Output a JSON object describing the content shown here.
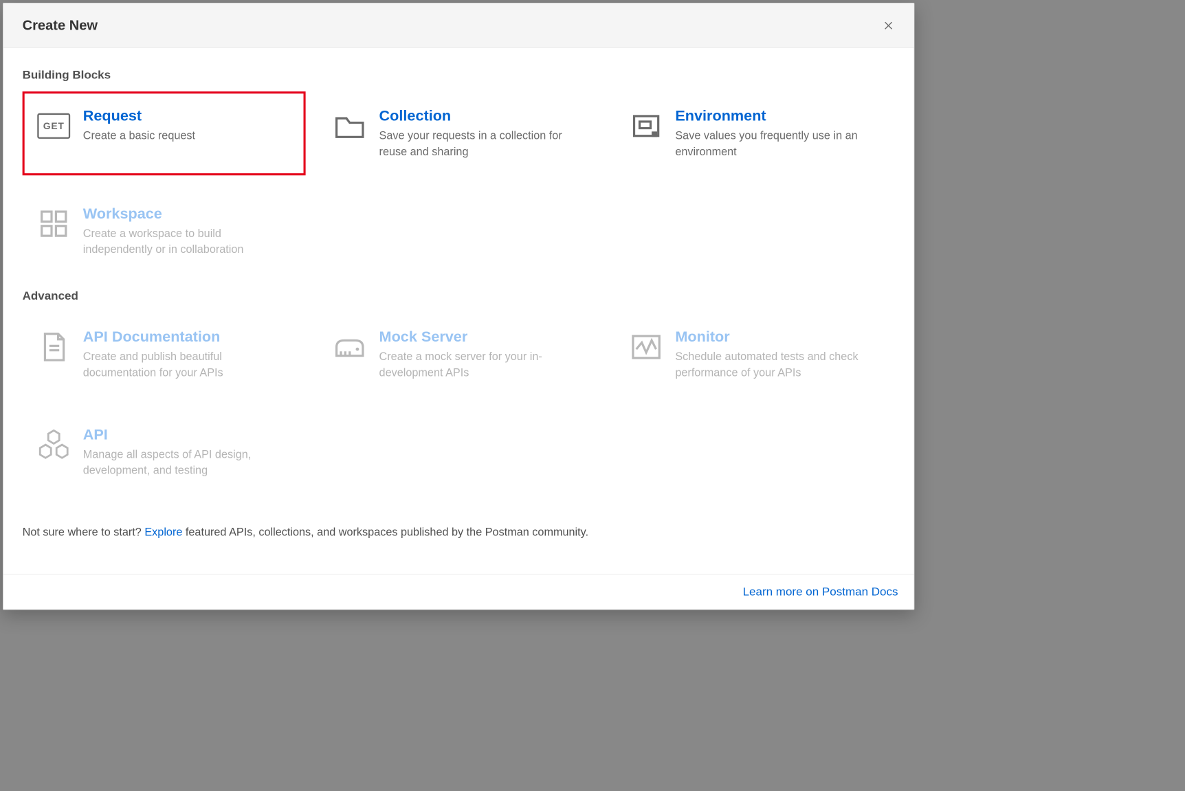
{
  "header": {
    "title": "Create New"
  },
  "sections": {
    "building_blocks": {
      "label": "Building Blocks",
      "items": {
        "request": {
          "title": "Request",
          "desc": "Create a basic request"
        },
        "collection": {
          "title": "Collection",
          "desc": "Save your requests in a collection for reuse and sharing"
        },
        "environment": {
          "title": "Environment",
          "desc": "Save values you frequently use in an environment"
        },
        "workspace": {
          "title": "Workspace",
          "desc": "Create a workspace to build independently or in collaboration"
        }
      }
    },
    "advanced": {
      "label": "Advanced",
      "items": {
        "api_doc": {
          "title": "API Documentation",
          "desc": "Create and publish beautiful documentation for your APIs"
        },
        "mock": {
          "title": "Mock Server",
          "desc": "Create a mock server for your in-development APIs"
        },
        "monitor": {
          "title": "Monitor",
          "desc": "Schedule automated tests and check performance of your APIs"
        },
        "api": {
          "title": "API",
          "desc": "Manage all aspects of API design, development, and testing"
        }
      }
    }
  },
  "hint": {
    "before": "Not sure where to start? ",
    "link": "Explore",
    "after": " featured APIs, collections, and workspaces published by the Postman community."
  },
  "footer": {
    "link": "Learn more on Postman Docs"
  }
}
